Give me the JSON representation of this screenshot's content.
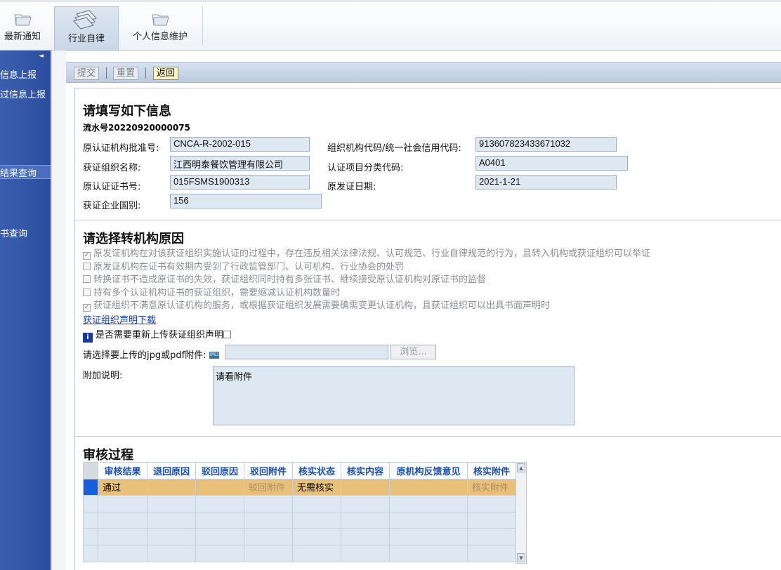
{
  "nav": {
    "tabs": [
      {
        "label": "最新通知",
        "icon": "folder-icon"
      },
      {
        "label": "行业自律",
        "icon": "documents-icon"
      },
      {
        "label": "个人信息维护",
        "icon": "folder-icon"
      }
    ]
  },
  "sidebar": {
    "collapse_glyph": "◄",
    "items": [
      "信息上报",
      "过信息上报",
      "结果查询",
      "书查询"
    ]
  },
  "toolbar": {
    "submit": "提交",
    "reset": "重置",
    "back": "返回"
  },
  "form": {
    "heading": "请填写如下信息",
    "serial": "流水号20220920000075",
    "fields": [
      {
        "label": "原认证机构批准号:",
        "value": "CNCA-R-2002-015"
      },
      {
        "label": "组织机构代码/统一社会信用代码:",
        "value": "913607823433671032"
      },
      {
        "label": "获证组织名称:",
        "value": "江西明泰餐饮管理有限公司"
      },
      {
        "label": "认证项目分类代码:",
        "value": "A0401"
      },
      {
        "label": "原认证证书号:",
        "value": "015FSMS1900313"
      },
      {
        "label": "原发证日期:",
        "value": "2021-1-21"
      },
      {
        "label": "获证企业国别:",
        "value": "156"
      }
    ]
  },
  "reasons": {
    "heading": "请选择转机构原因",
    "options": [
      {
        "text": "原发证机构在对该获证组织实施认证的过程中，存在违反相关法律法规、认可规范、行业自律规范的行为，且转入机构或获证组织可以举证",
        "checked": true
      },
      {
        "text": "原发证机构在证书有效期内受到了行政监管部门、认可机构、行业协会的处罚",
        "checked": false
      },
      {
        "text": "转换证书不造成原证书的失效，获证组织同时持有多张证书、继续接受原认证机构对原证书的监督",
        "checked": false
      },
      {
        "text": "持有多个认证机构证书的获证组织，需要缩减认证机构数量时",
        "checked": false
      },
      {
        "text": "获证组织不满意原认证机构的服务，或根据获证组织发展需要确需变更认证机构，且获证组织可以出具书面声明时",
        "checked": true
      }
    ],
    "download_link": "获证组织声明下载",
    "reupload_label": "是否需要重新上传获证组织声明",
    "upload_label": "请选择要上传的jpg或pdf附件:",
    "browse": "浏览...",
    "note_label": "附加说明:",
    "note_value": "请看附件"
  },
  "review": {
    "heading": "审核过程",
    "columns": [
      "审核结果",
      "退回原因",
      "驳回原因",
      "驳回附件",
      "核实状态",
      "核实内容",
      "原机构反馈意见",
      "核实附件"
    ],
    "rows": [
      [
        "通过",
        "",
        "",
        "驳回附件",
        "无需核实",
        "",
        "",
        "核实附件"
      ]
    ]
  }
}
